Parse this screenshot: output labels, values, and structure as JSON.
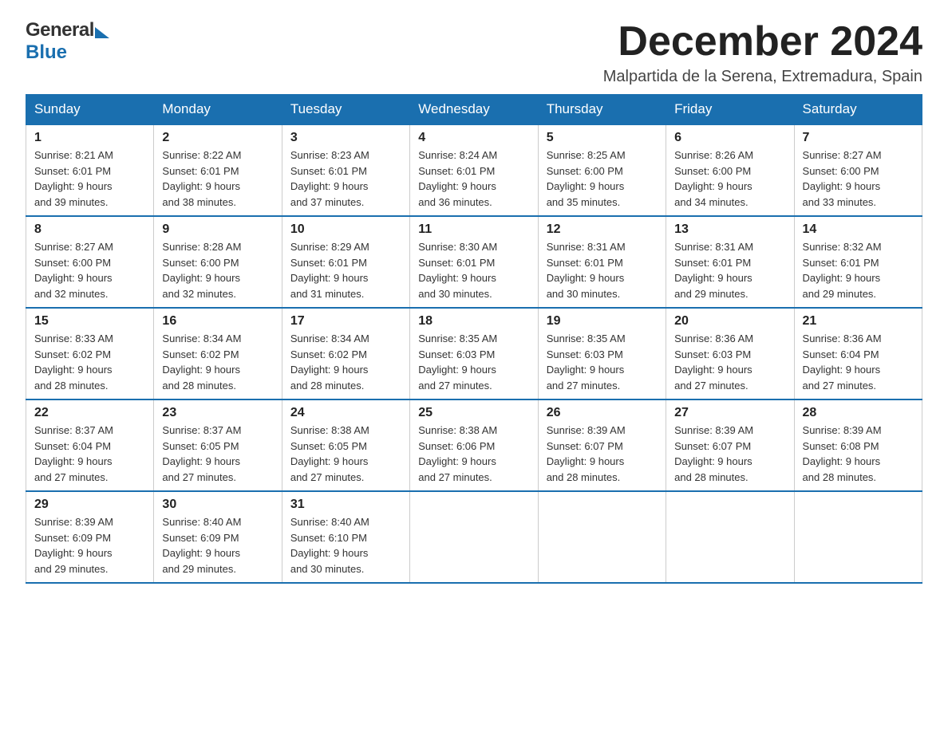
{
  "header": {
    "logo_general": "General",
    "logo_blue": "Blue",
    "title": "December 2024",
    "location": "Malpartida de la Serena, Extremadura, Spain"
  },
  "days_of_week": [
    "Sunday",
    "Monday",
    "Tuesday",
    "Wednesday",
    "Thursday",
    "Friday",
    "Saturday"
  ],
  "weeks": [
    [
      {
        "day": "1",
        "sunrise": "8:21 AM",
        "sunset": "6:01 PM",
        "daylight": "9 hours and 39 minutes."
      },
      {
        "day": "2",
        "sunrise": "8:22 AM",
        "sunset": "6:01 PM",
        "daylight": "9 hours and 38 minutes."
      },
      {
        "day": "3",
        "sunrise": "8:23 AM",
        "sunset": "6:01 PM",
        "daylight": "9 hours and 37 minutes."
      },
      {
        "day": "4",
        "sunrise": "8:24 AM",
        "sunset": "6:01 PM",
        "daylight": "9 hours and 36 minutes."
      },
      {
        "day": "5",
        "sunrise": "8:25 AM",
        "sunset": "6:00 PM",
        "daylight": "9 hours and 35 minutes."
      },
      {
        "day": "6",
        "sunrise": "8:26 AM",
        "sunset": "6:00 PM",
        "daylight": "9 hours and 34 minutes."
      },
      {
        "day": "7",
        "sunrise": "8:27 AM",
        "sunset": "6:00 PM",
        "daylight": "9 hours and 33 minutes."
      }
    ],
    [
      {
        "day": "8",
        "sunrise": "8:27 AM",
        "sunset": "6:00 PM",
        "daylight": "9 hours and 32 minutes."
      },
      {
        "day": "9",
        "sunrise": "8:28 AM",
        "sunset": "6:00 PM",
        "daylight": "9 hours and 32 minutes."
      },
      {
        "day": "10",
        "sunrise": "8:29 AM",
        "sunset": "6:01 PM",
        "daylight": "9 hours and 31 minutes."
      },
      {
        "day": "11",
        "sunrise": "8:30 AM",
        "sunset": "6:01 PM",
        "daylight": "9 hours and 30 minutes."
      },
      {
        "day": "12",
        "sunrise": "8:31 AM",
        "sunset": "6:01 PM",
        "daylight": "9 hours and 30 minutes."
      },
      {
        "day": "13",
        "sunrise": "8:31 AM",
        "sunset": "6:01 PM",
        "daylight": "9 hours and 29 minutes."
      },
      {
        "day": "14",
        "sunrise": "8:32 AM",
        "sunset": "6:01 PM",
        "daylight": "9 hours and 29 minutes."
      }
    ],
    [
      {
        "day": "15",
        "sunrise": "8:33 AM",
        "sunset": "6:02 PM",
        "daylight": "9 hours and 28 minutes."
      },
      {
        "day": "16",
        "sunrise": "8:34 AM",
        "sunset": "6:02 PM",
        "daylight": "9 hours and 28 minutes."
      },
      {
        "day": "17",
        "sunrise": "8:34 AM",
        "sunset": "6:02 PM",
        "daylight": "9 hours and 28 minutes."
      },
      {
        "day": "18",
        "sunrise": "8:35 AM",
        "sunset": "6:03 PM",
        "daylight": "9 hours and 27 minutes."
      },
      {
        "day": "19",
        "sunrise": "8:35 AM",
        "sunset": "6:03 PM",
        "daylight": "9 hours and 27 minutes."
      },
      {
        "day": "20",
        "sunrise": "8:36 AM",
        "sunset": "6:03 PM",
        "daylight": "9 hours and 27 minutes."
      },
      {
        "day": "21",
        "sunrise": "8:36 AM",
        "sunset": "6:04 PM",
        "daylight": "9 hours and 27 minutes."
      }
    ],
    [
      {
        "day": "22",
        "sunrise": "8:37 AM",
        "sunset": "6:04 PM",
        "daylight": "9 hours and 27 minutes."
      },
      {
        "day": "23",
        "sunrise": "8:37 AM",
        "sunset": "6:05 PM",
        "daylight": "9 hours and 27 minutes."
      },
      {
        "day": "24",
        "sunrise": "8:38 AM",
        "sunset": "6:05 PM",
        "daylight": "9 hours and 27 minutes."
      },
      {
        "day": "25",
        "sunrise": "8:38 AM",
        "sunset": "6:06 PM",
        "daylight": "9 hours and 27 minutes."
      },
      {
        "day": "26",
        "sunrise": "8:39 AM",
        "sunset": "6:07 PM",
        "daylight": "9 hours and 28 minutes."
      },
      {
        "day": "27",
        "sunrise": "8:39 AM",
        "sunset": "6:07 PM",
        "daylight": "9 hours and 28 minutes."
      },
      {
        "day": "28",
        "sunrise": "8:39 AM",
        "sunset": "6:08 PM",
        "daylight": "9 hours and 28 minutes."
      }
    ],
    [
      {
        "day": "29",
        "sunrise": "8:39 AM",
        "sunset": "6:09 PM",
        "daylight": "9 hours and 29 minutes."
      },
      {
        "day": "30",
        "sunrise": "8:40 AM",
        "sunset": "6:09 PM",
        "daylight": "9 hours and 29 minutes."
      },
      {
        "day": "31",
        "sunrise": "8:40 AM",
        "sunset": "6:10 PM",
        "daylight": "9 hours and 30 minutes."
      },
      null,
      null,
      null,
      null
    ]
  ],
  "labels": {
    "sunrise": "Sunrise:",
    "sunset": "Sunset:",
    "daylight": "Daylight:"
  }
}
